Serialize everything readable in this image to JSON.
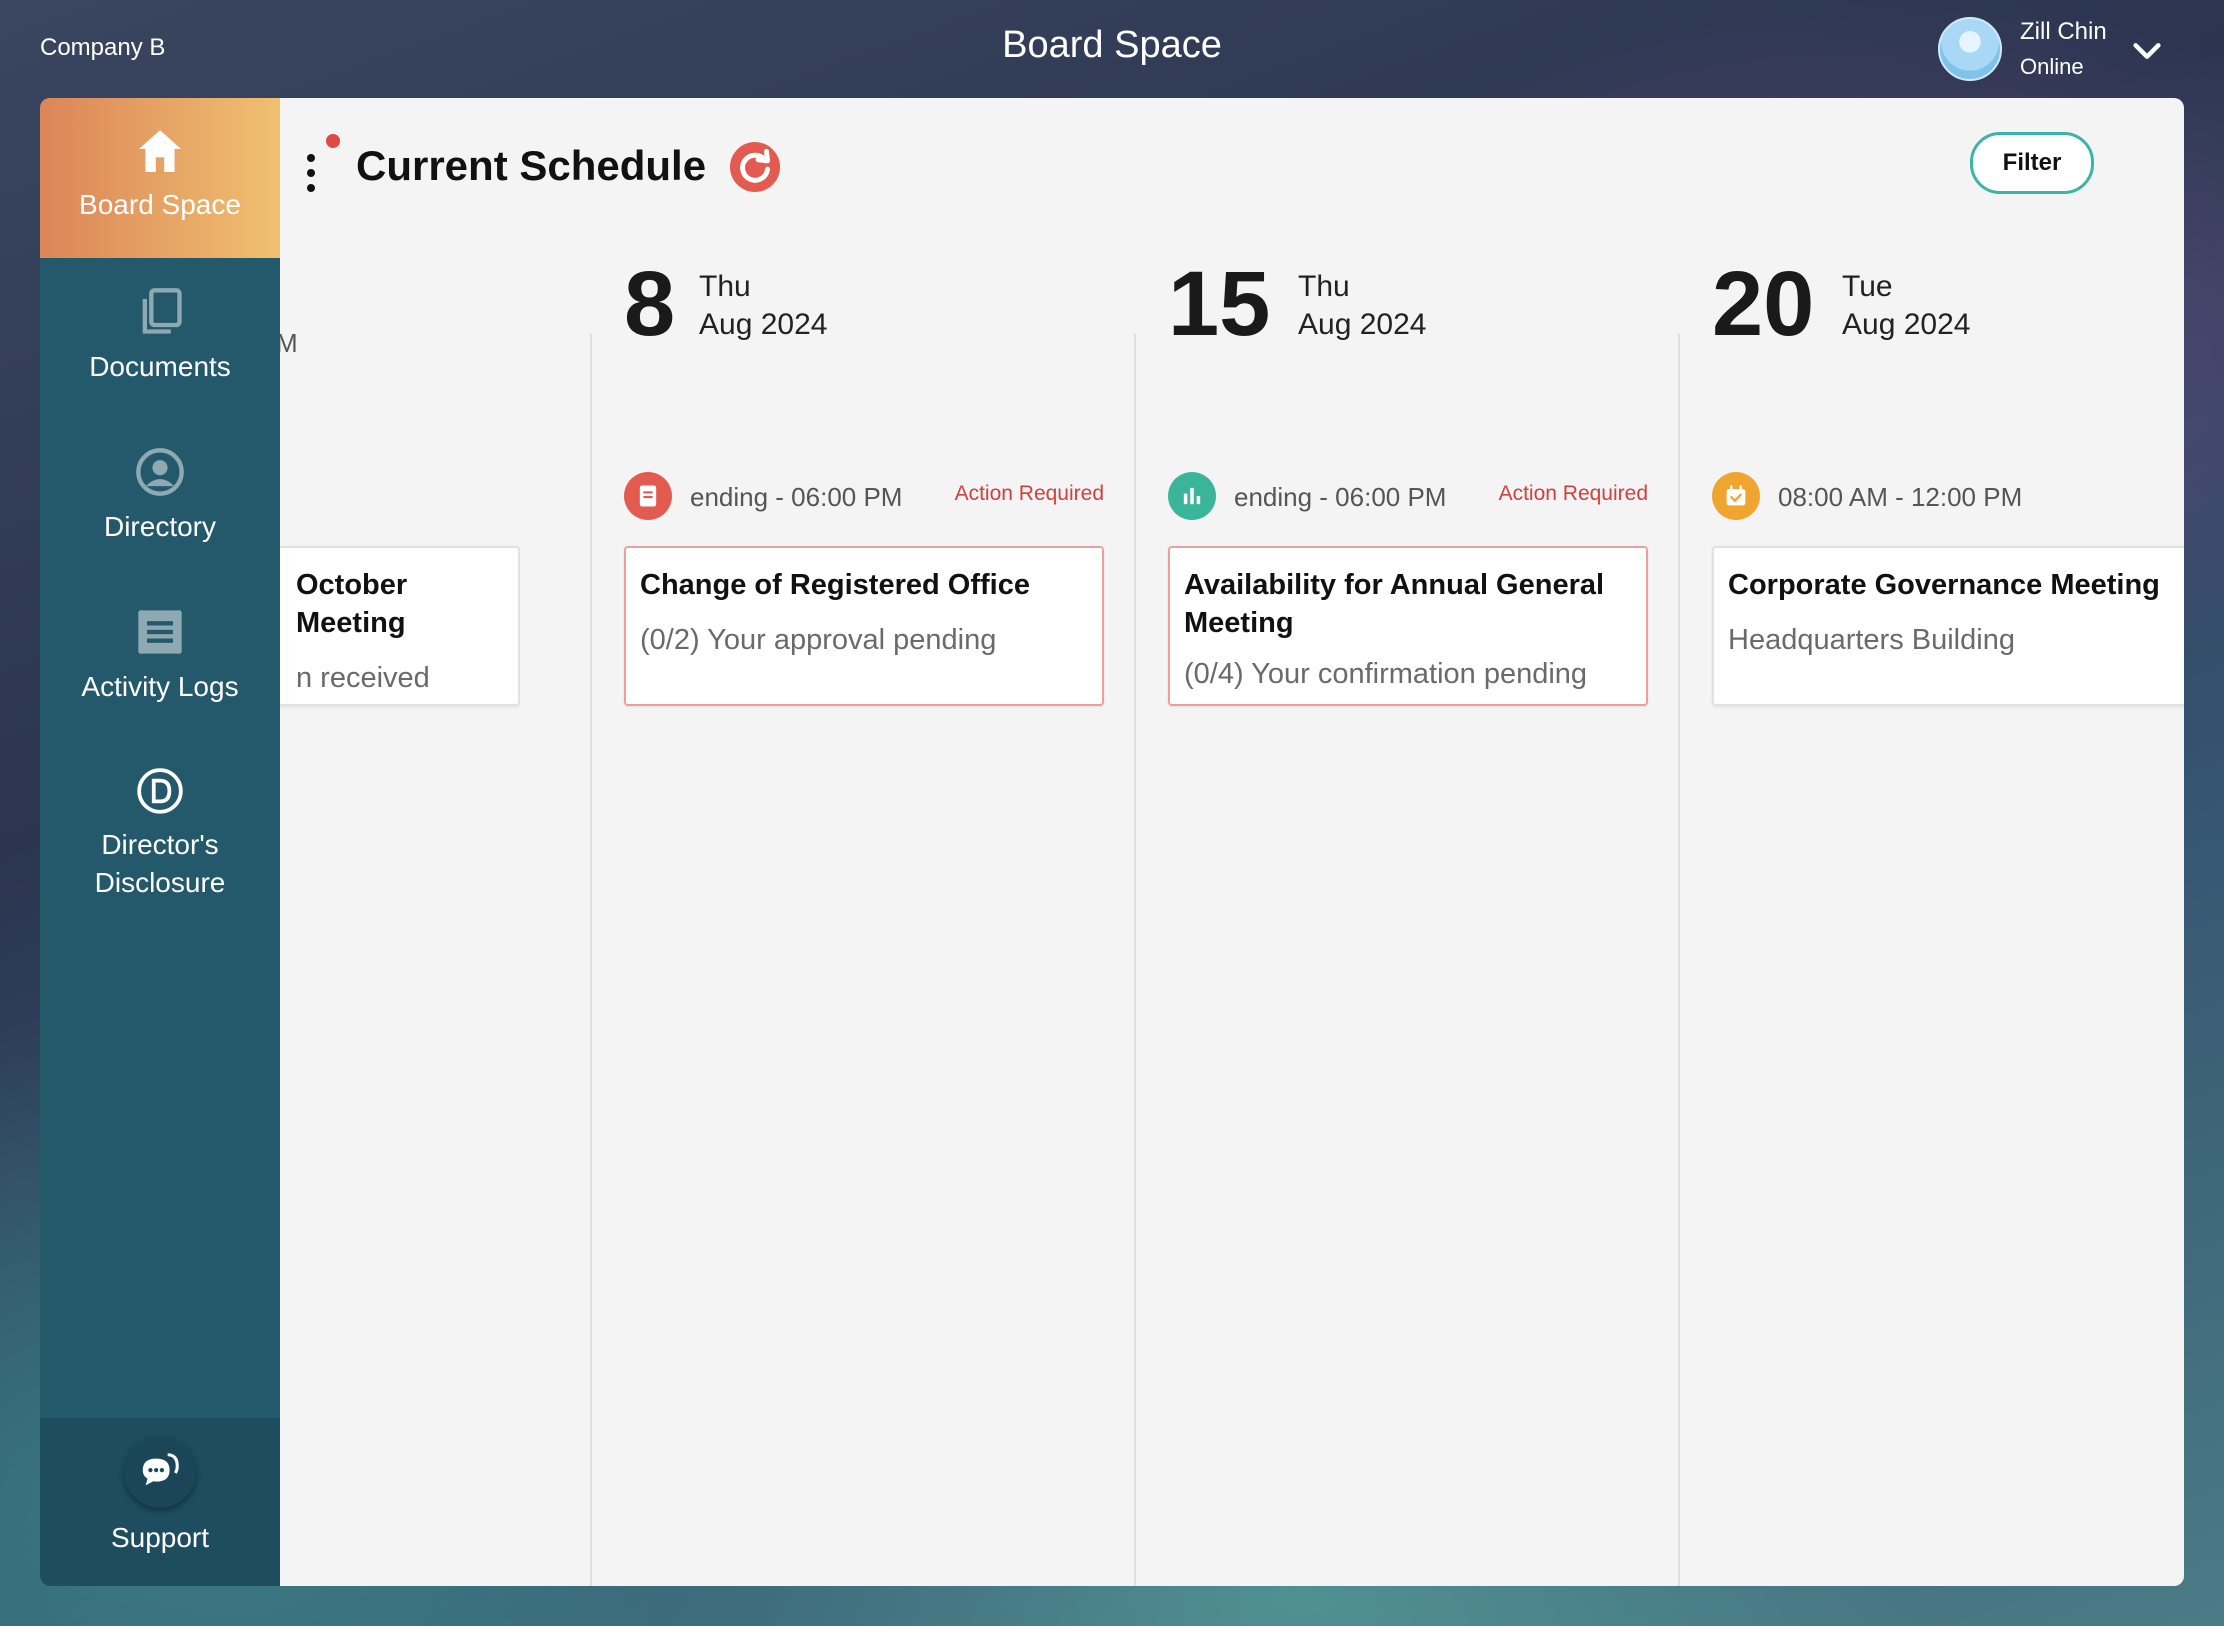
{
  "header": {
    "company": "Company B",
    "title": "Board Space",
    "user_name": "Zill Chin",
    "user_status": "Online"
  },
  "sidebar": {
    "items": [
      {
        "label": "Board Space",
        "icon": "home-icon"
      },
      {
        "label": "Documents",
        "icon": "documents-icon"
      },
      {
        "label": "Directory",
        "icon": "user-circle-icon"
      },
      {
        "label": "Activity Logs",
        "icon": "list-icon"
      },
      {
        "label": "Director's Disclosure",
        "icon": "disclosure-d-icon"
      }
    ],
    "support": "Support"
  },
  "schedule": {
    "title": "Current Schedule",
    "filter": "Filter",
    "partial": {
      "time": "M",
      "title": "October Meeting",
      "subtitle": "n received"
    },
    "columns": [
      {
        "day": "8",
        "weekday": "Thu",
        "month": "Aug 2024",
        "time": "ending - 06:00 PM",
        "action": "Action Required",
        "icon": "document-note-icon",
        "icon_color": "#e35a50",
        "title": "Change of Registered Office",
        "subtitle": "(0/2) Your approval pending"
      },
      {
        "day": "15",
        "weekday": "Thu",
        "month": "Aug 2024",
        "time": "ending - 06:00 PM",
        "action": "Action Required",
        "icon": "bar-chart-icon",
        "icon_color": "#3bb59a",
        "title": "Availability for Annual General Meeting",
        "subtitle": "(0/4) Your confirmation pending"
      },
      {
        "day": "20",
        "weekday": "Tue",
        "month": "Aug 2024",
        "time": "08:00 AM - 12:00 PM",
        "action": "",
        "icon": "calendar-check-icon",
        "icon_color": "#f0a530",
        "title": "Corporate Governance Meeting",
        "subtitle": "Headquarters Building"
      }
    ]
  },
  "colors": {
    "sidebar": "#23596b",
    "active_start": "#dc8558",
    "active_end": "#f0c070",
    "accent": "#3bb5a6",
    "alert": "#d04040"
  }
}
